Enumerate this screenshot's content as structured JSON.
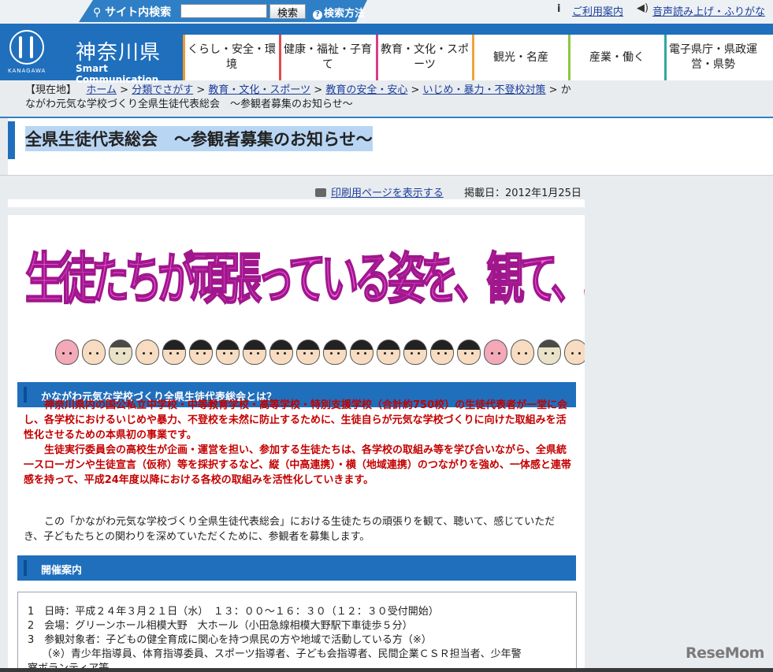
{
  "topbar": {
    "search_label": "サイト内検索",
    "search_button": "検索",
    "search_help": "検索方法",
    "usage_guide": "ご利用案内",
    "read_aloud": "音声読み上げ・ふりがな"
  },
  "header": {
    "prefecture": "神奈川県",
    "tagline": "Smart Communication",
    "logo_sub": "KANAGAWA"
  },
  "nav": [
    {
      "label": "くらし・安全・環境",
      "color": "#f19a2c"
    },
    {
      "label": "健康・福祉・子育て",
      "color": "#e04a4a"
    },
    {
      "label": "教育・文化・スポーツ",
      "color": "#d93d8a"
    },
    {
      "label": "観光・名産",
      "color": "#f2a33a"
    },
    {
      "label": "産業・働く",
      "color": "#8cc63f"
    },
    {
      "label": "電子県庁・県政運営・県勢",
      "color": "#2fa6a0"
    }
  ],
  "breadcrumb": {
    "prefix": "【現在地】",
    "items": [
      "ホーム",
      "分類でさがす",
      "教育・文化・スポーツ",
      "教育の安全・安心",
      "いじめ・暴力・不登校対策"
    ],
    "current": "かながわ元気な学校づくり全県生徒代表総会　～参観者募集のお知らせ～"
  },
  "page": {
    "title": "全県生徒代表総会　～参観者募集のお知らせ～",
    "print_link": "印刷用ページを表示する",
    "posted_date": "掲載日：2012年1月25日"
  },
  "banner": {
    "text": "生徒たちが頑張っている姿を、観て、聴いて、感じてみませんか？"
  },
  "section1": {
    "heading": "かながわ元気な学校づくり全県生徒代表総会とは？",
    "red_paragraphs": [
      "神奈川県内の国公私立中学校・中等教育学校・高等学校・特別支援学校（合計約750校）の生徒代表者が一堂に会し、各学校におけるいじめや暴力、不登校を未然に防止するために、生徒自らが元気な学校づくりに向けた取組みを活性化させるための本県初の事業です。",
      "生徒実行委員会の高校生が企画・運営を担い、参加する生徒たちは、各学校の取組み等を学び合いながら、全県統一スローガンや生徒宣言（仮称）等を採択するなど、縦（中高連携）・横（地域連携）のつながりを強め、一体感と連帯感を持って、平成24年度以降における各校の取組みを活性化していきます。"
    ],
    "body": "この「かながわ元気な学校づくり全県生徒代表総会」における生徒たちの頑張りを観て、聴いて、感じていただき、子どもたちとの関わりを深めていただくために、参観者を募集します。"
  },
  "section2": {
    "heading": "開催案内",
    "lines": [
      "1　日時：平成２４年３月２１日（水）　１３：００～１６：３０（１２：３０受付開始）",
      "2　会場：グリーンホール相模大野　大ホール（小田急線相模大野駅下車徒歩５分）",
      "3　参観対象者：子どもの健全育成に関心を持つ県民の方や地域で活動している方（※）",
      "（※）青少年指導員、体育指導委員、スポーツ指導者、子ども会指導者、民間企業ＣＳＲ担当者、少年警",
      "察ボランティア等"
    ]
  },
  "watermark": "ReseMom"
}
